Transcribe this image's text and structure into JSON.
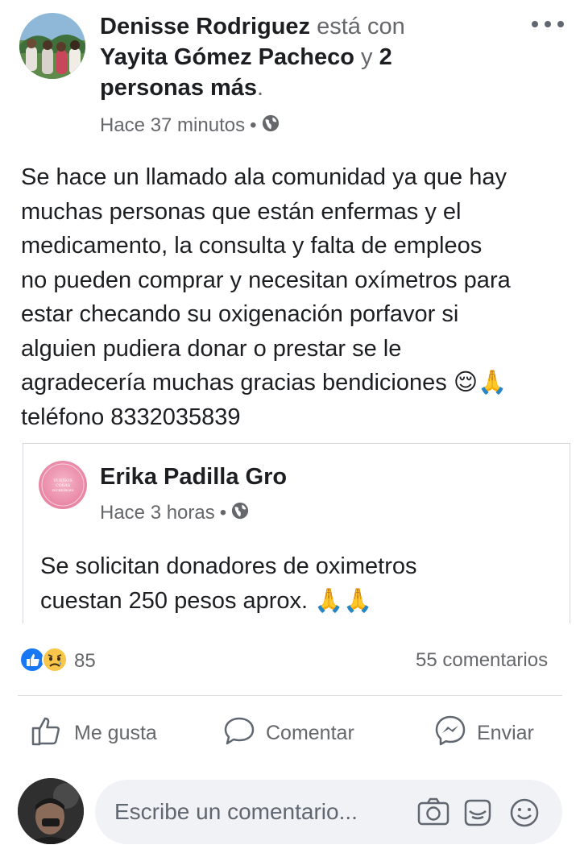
{
  "post": {
    "author": "Denisse Rodriguez",
    "with_word": " está con ",
    "tagged": "Yayita Gómez Pacheco",
    "and_word": " y ",
    "others": "2 personas más",
    "period": ".",
    "time": "Hace 37 minutos",
    "separator": "•",
    "privacy_icon": "globe-icon",
    "text": "Se hace un llamado ala comunidad ya que hay\nmuchas personas que están enfermas y el\nmedicamento, la consulta y falta de empleos\nno pueden comprar y necesitan oxímetros para\nestar checando su oxigenación porfavor si\nalguien pudiera donar o prestar se le\nagradecería muchas gracias bendiciones",
    "emojis_1": "😌🙏",
    "phone_line": "teléfono 8332035839"
  },
  "shared_post": {
    "author": "Erika Padilla Gro",
    "time": "Hace 3 horas",
    "separator": "•",
    "text": "Se solicitan donadores de oximetros\ncuestan 250 pesos aprox.",
    "emojis": "🙏🙏",
    "avatar_text": "VUEÑOS PEQUE... COSAS INCREIBLES"
  },
  "stats": {
    "reaction_icons": [
      "like-icon",
      "sad-icon"
    ],
    "reactions_count": "85",
    "comments_count": "55 comentarios"
  },
  "actions": {
    "like": "Me gusta",
    "comment": "Comentar",
    "share": "Enviar"
  },
  "composer": {
    "placeholder": "Escribe un comentario..."
  },
  "colors": {
    "text": "#1c1e21",
    "muted": "#65676b",
    "like_blue": "#1877f2",
    "divider": "#dadde1",
    "composer_bg": "#f0f2f5"
  }
}
